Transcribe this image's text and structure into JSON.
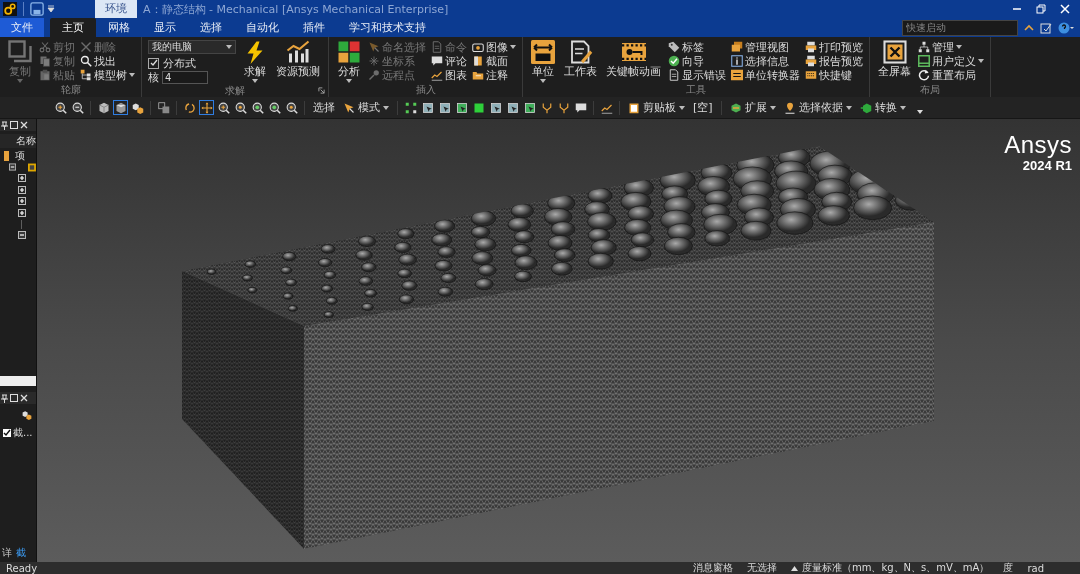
{
  "title_bar": {
    "context_tab": {
      "label": "环境",
      "selected": true
    },
    "title": "A：静态结构 - Mechanical [Ansys Mechanical Enterprise]"
  },
  "ribbon_tabs": [
    {
      "label": "文件",
      "kind": "file",
      "selected": false
    },
    {
      "label": "主页",
      "kind": "tab",
      "selected": true
    },
    {
      "label": "网格",
      "kind": "tab",
      "selected": false
    },
    {
      "label": "显示",
      "kind": "tab",
      "selected": false
    },
    {
      "label": "选择",
      "kind": "tab",
      "selected": false
    },
    {
      "label": "自动化",
      "kind": "tab",
      "selected": false
    },
    {
      "label": "插件",
      "kind": "tab",
      "selected": false
    },
    {
      "label": "学习和技术支持",
      "kind": "tab",
      "selected": false
    }
  ],
  "quick_launch": {
    "placeholder": "快速启动"
  },
  "ribbon_groups": [
    {
      "label": "轮廓",
      "launcher": false,
      "items": [
        {
          "kind": "large",
          "label": "复制",
          "dropdown": true,
          "disabled": true
        },
        {
          "kind": "column",
          "items": [
            {
              "kind": "button",
              "label": "剪切",
              "dropdown": false,
              "disabled": true
            },
            {
              "kind": "button",
              "label": "复制",
              "dropdown": false,
              "disabled": true
            },
            {
              "kind": "button",
              "label": "粘贴",
              "dropdown": false,
              "disabled": true
            }
          ]
        },
        {
          "kind": "column",
          "items": [
            {
              "kind": "button",
              "label": "删除",
              "dropdown": false,
              "disabled": true
            },
            {
              "kind": "button",
              "label": "找出",
              "dropdown": false,
              "disabled": false
            },
            {
              "kind": "button",
              "label": "模型树",
              "dropdown": true,
              "disabled": false
            }
          ]
        }
      ]
    },
    {
      "label": "求解",
      "launcher": true,
      "items": [
        {
          "kind": "column",
          "items": [
            {
              "kind": "select",
              "label": "我的电脑"
            },
            {
              "kind": "checkbox",
              "label": "分布式",
              "checked": true
            },
            {
              "kind": "field",
              "label": "核",
              "value": "4"
            }
          ]
        },
        {
          "kind": "large",
          "label": "求解",
          "dropdown": true,
          "disabled": false
        },
        {
          "kind": "large",
          "label": "资源预测",
          "dropdown": false,
          "disabled": false
        }
      ]
    },
    {
      "label": "插入",
      "launcher": false,
      "items": [
        {
          "kind": "large",
          "label": "分析",
          "dropdown": true,
          "disabled": false
        },
        {
          "kind": "column",
          "items": [
            {
              "kind": "button",
              "label": "命名选择",
              "dropdown": false,
              "disabled": true
            },
            {
              "kind": "button",
              "label": "坐标系",
              "dropdown": false,
              "disabled": true
            },
            {
              "kind": "button",
              "label": "远程点",
              "dropdown": false,
              "disabled": true
            }
          ]
        },
        {
          "kind": "column",
          "items": [
            {
              "kind": "button",
              "label": "命令",
              "dropdown": false,
              "disabled": true
            },
            {
              "kind": "button",
              "label": "评论",
              "dropdown": false,
              "disabled": false
            },
            {
              "kind": "button",
              "label": "图表",
              "dropdown": false,
              "disabled": false
            }
          ]
        },
        {
          "kind": "column",
          "items": [
            {
              "kind": "button",
              "label": "图像",
              "dropdown": true,
              "disabled": false
            },
            {
              "kind": "button",
              "label": "截面",
              "dropdown": false,
              "disabled": false
            },
            {
              "kind": "button",
              "label": "注释",
              "dropdown": false,
              "disabled": false
            }
          ]
        }
      ]
    },
    {
      "label": "工具",
      "launcher": false,
      "items": [
        {
          "kind": "large",
          "label": "单位",
          "dropdown": true,
          "disabled": false
        },
        {
          "kind": "large",
          "label": "工作表",
          "dropdown": false,
          "disabled": false
        },
        {
          "kind": "large",
          "label": "关键帧动画",
          "dropdown": false,
          "disabled": false
        },
        {
          "kind": "column",
          "items": [
            {
              "kind": "button",
              "label": "标签",
              "dropdown": false,
              "disabled": false
            },
            {
              "kind": "button",
              "label": "向导",
              "dropdown": false,
              "disabled": false
            },
            {
              "kind": "button",
              "label": "显示错误",
              "dropdown": false,
              "disabled": false
            }
          ]
        },
        {
          "kind": "column",
          "items": [
            {
              "kind": "button",
              "label": "管理视图",
              "dropdown": false,
              "disabled": false
            },
            {
              "kind": "button",
              "label": "选择信息",
              "dropdown": false,
              "disabled": false
            },
            {
              "kind": "button",
              "label": "单位转换器",
              "dropdown": false,
              "disabled": false
            }
          ]
        },
        {
          "kind": "column",
          "items": [
            {
              "kind": "button",
              "label": "打印预览",
              "dropdown": false,
              "disabled": false
            },
            {
              "kind": "button",
              "label": "报告预览",
              "dropdown": false,
              "disabled": false
            },
            {
              "kind": "button",
              "label": "快捷键",
              "dropdown": false,
              "disabled": false
            }
          ]
        }
      ]
    },
    {
      "label": "布局",
      "launcher": false,
      "items": [
        {
          "kind": "large",
          "label": "全屏幕",
          "dropdown": false,
          "disabled": false
        },
        {
          "kind": "column",
          "items": [
            {
              "kind": "button",
              "label": "管理",
              "dropdown": true,
              "disabled": false
            },
            {
              "kind": "button",
              "label": "用户定义",
              "dropdown": true,
              "disabled": false
            },
            {
              "kind": "button",
              "label": "重置布局",
              "dropdown": false,
              "disabled": false
            }
          ]
        }
      ]
    }
  ],
  "toolbar": [
    {
      "kind": "icon",
      "selected": false
    },
    {
      "kind": "icon",
      "selected": false
    },
    {
      "kind": "sep"
    },
    {
      "kind": "icon",
      "selected": false
    },
    {
      "kind": "icon",
      "selected": true
    },
    {
      "kind": "icon",
      "selected": false
    },
    {
      "kind": "sep"
    },
    {
      "kind": "icon",
      "selected": false
    },
    {
      "kind": "sep"
    },
    {
      "kind": "icon",
      "selected": false
    },
    {
      "kind": "icon",
      "selected": true
    },
    {
      "kind": "icon",
      "selected": false
    },
    {
      "kind": "icon",
      "selected": false
    },
    {
      "kind": "icon",
      "selected": false
    },
    {
      "kind": "icon",
      "selected": false
    },
    {
      "kind": "icon",
      "selected": false
    },
    {
      "kind": "sep"
    },
    {
      "kind": "label",
      "label": "选择"
    },
    {
      "kind": "menu",
      "label": "模式"
    },
    {
      "kind": "sep"
    },
    {
      "kind": "icon",
      "selected": false
    },
    {
      "kind": "icon",
      "selected": false
    },
    {
      "kind": "icon",
      "selected": false
    },
    {
      "kind": "icon",
      "selected": false
    },
    {
      "kind": "icon",
      "selected": false
    },
    {
      "kind": "icon",
      "selected": false
    },
    {
      "kind": "icon",
      "selected": false
    },
    {
      "kind": "icon",
      "selected": false
    },
    {
      "kind": "icon",
      "selected": false
    },
    {
      "kind": "icon",
      "selected": false
    },
    {
      "kind": "icon",
      "selected": false
    },
    {
      "kind": "sep"
    },
    {
      "kind": "icon",
      "selected": false
    },
    {
      "kind": "sep"
    },
    {
      "kind": "menu",
      "label": "剪贴板"
    },
    {
      "kind": "label",
      "label": "[空]"
    },
    {
      "kind": "sep"
    },
    {
      "kind": "menu",
      "label": "扩展"
    },
    {
      "kind": "menu",
      "label": "选择依据"
    },
    {
      "kind": "menu",
      "label": "转换"
    },
    {
      "kind": "overflow"
    }
  ],
  "outline_panel": {
    "header": "名称",
    "tree": [
      {
        "label": "项",
        "children": [
          {
            "kind": "folder",
            "expanded": true,
            "children": [
              {
                "kind": "folder",
                "expanded": false
              },
              {
                "kind": "folder",
                "expanded": false
              },
              {
                "kind": "folder",
                "expanded": false
              },
              {
                "kind": "folder",
                "expanded": false
              },
              {
                "kind": "leaf",
                "expanded": false
              },
              {
                "kind": "folder",
                "expanded": true
              }
            ]
          }
        ]
      }
    ]
  },
  "details_panel": {
    "rows": [
      {
        "label": "截...",
        "checked": true
      }
    ],
    "tabs": [
      {
        "label": "详",
        "selected": false
      },
      {
        "label": "截",
        "selected": true
      }
    ]
  },
  "viewport": {
    "logo": {
      "name": "Ansys",
      "version": "2024 R1"
    }
  },
  "status_bar": {
    "ready": "Ready",
    "items": [
      {
        "kind": "text",
        "label": "消息窗格"
      },
      {
        "kind": "text",
        "label": "无选择"
      },
      {
        "kind": "menu",
        "label": "度量标准（mm、kg、N、s、mV、mA）"
      },
      {
        "kind": "text",
        "label": "度"
      },
      {
        "kind": "text",
        "label": "rad"
      }
    ]
  }
}
